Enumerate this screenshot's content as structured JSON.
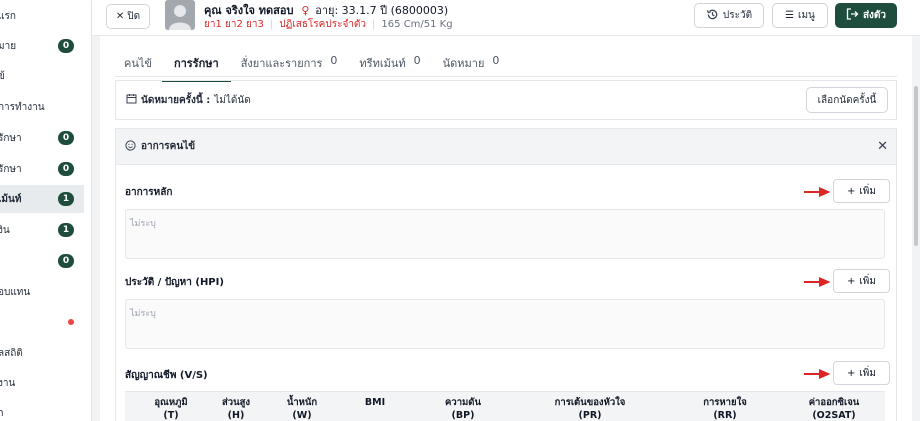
{
  "sidebar": {
    "items": [
      {
        "label": "แรก",
        "badge": null
      },
      {
        "label": "มาย",
        "badge": "0"
      },
      {
        "label": "ข้",
        "badge": null
      },
      {
        "label": "การทำงาน",
        "badge": null
      },
      {
        "label": "รักษา",
        "badge": "0"
      },
      {
        "label": "รักษา",
        "badge": "0"
      },
      {
        "label": "เม้นท์",
        "badge": "1"
      },
      {
        "label": "งิน",
        "badge": "1"
      },
      {
        "label": "",
        "badge": "0"
      },
      {
        "label": "อบแทน",
        "badge": null
      },
      {
        "label": "",
        "badge": null
      },
      {
        "label": "ลสถิติ",
        "badge": null
      },
      {
        "label": "งาน",
        "badge": null
      },
      {
        "label": "า",
        "badge": null
      }
    ]
  },
  "header": {
    "close_label": "ปิด",
    "patient_name": "คุณ จริงใจ ทดสอบ",
    "gender_symbol": "♀",
    "age_text": "อายุ: 33.1.7 ปี (6800003)",
    "drugs": "ยา1 ยา2 ยา3",
    "allergy": "ปฏิเสธโรคประจำตัว",
    "body": "165 Cm/51 Kg",
    "history_label": "ประวัติ",
    "menu_label": "เมนู",
    "send_label": "ส่งตัว"
  },
  "tabs": [
    {
      "label": "คนไข้",
      "count": ""
    },
    {
      "label": "การรักษา",
      "count": ""
    },
    {
      "label": "สั่งยาและรายการ",
      "count": "0"
    },
    {
      "label": "ทรีทเม้นท์",
      "count": "0"
    },
    {
      "label": "นัดหมาย",
      "count": "0"
    }
  ],
  "appointment": {
    "label": "นัดหมายครั้งนี้ :",
    "value": "ไม่ได้นัด",
    "button": "เลือกนัดครั้งนี้"
  },
  "symptoms": {
    "title": "อาการคนไข้",
    "add_label": "เพิ่ม",
    "placeholder": "ไม่ระบุ",
    "sections": [
      {
        "title": "อาการหลัก"
      },
      {
        "title": "ประวัติ / ปัญหา (HPI)"
      },
      {
        "title": "สัญญาณชีพ (V/S)"
      }
    ],
    "vitals_columns": [
      {
        "l1": "อุณหภูมิ",
        "l2": "(T)"
      },
      {
        "l1": "ส่วนสูง",
        "l2": "(H)"
      },
      {
        "l1": "น้ำหนัก",
        "l2": "(W)"
      },
      {
        "l1": "BMI",
        "l2": ""
      },
      {
        "l1": "ความดัน",
        "l2": "(BP)"
      },
      {
        "l1": "การเต้นของหัวใจ",
        "l2": "(PR)"
      },
      {
        "l1": "การหายใจ",
        "l2": "(RR)"
      },
      {
        "l1": "ค่าออกซิเจน",
        "l2": "(O2SAT)"
      }
    ]
  },
  "colors": {
    "primary": "#1e4d3d",
    "arrow": "#dc2626"
  }
}
